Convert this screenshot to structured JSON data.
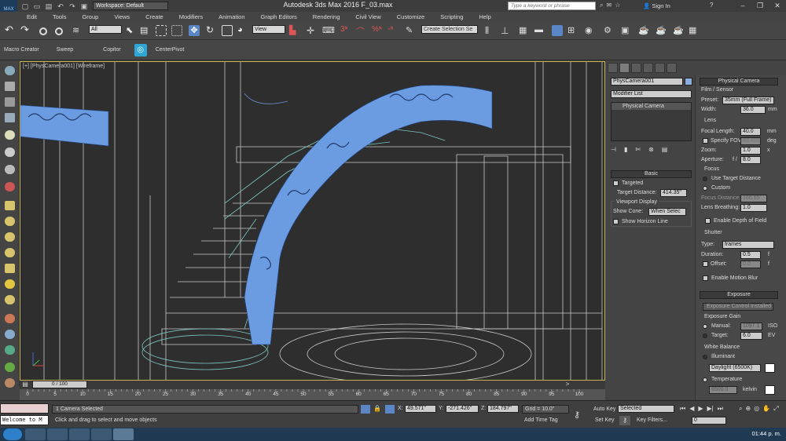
{
  "titlebar": {
    "logo": "MAX",
    "workspace": "Workspace: Default",
    "title": "Autodesk 3ds Max 2016    F_03.max",
    "search_placeholder": "Type a keyword or phrase",
    "sign_in": "Sign In",
    "help": "?"
  },
  "menus": [
    "Edit",
    "Tools",
    "Group",
    "Views",
    "Create",
    "Modifiers",
    "Animation",
    "Graph Editors",
    "Rendering",
    "Civil View",
    "Customize",
    "Scripting",
    "Help"
  ],
  "toolbar": {
    "selection_filter": "All",
    "ref_coord": "View",
    "named_sel": "Create Selection Se"
  },
  "ribbon": {
    "items": [
      "Macro Creator",
      "Sweep",
      "Copitor",
      "CenterPivot"
    ]
  },
  "viewport": {
    "label": "[+] [PhysCamera001] [Wireframe]"
  },
  "command_panel": {
    "object_name": "PhysCamera001",
    "color": "#8aaee0",
    "modifier_list": "Modifier List",
    "stack_item": "Physical Camera",
    "basic": {
      "title": "Basic",
      "targeted": "Targeted",
      "target_distance_label": "Target Distance:",
      "target_distance": "414.35\"",
      "viewport_display": "Viewport Display",
      "show_cone_label": "Show Cone:",
      "show_cone": "When Selec",
      "show_horizon": "Show Horizon Line"
    },
    "physical_camera": {
      "title": "Physical Camera",
      "film_sensor": "Film / Sensor",
      "preset_label": "Preset:",
      "preset": "35mm (Full Frame)",
      "width_label": "Width:",
      "width": "36.0",
      "width_unit": "mm",
      "lens": "Lens",
      "focal_length_label": "Focal Length:",
      "focal_length": "40.0",
      "focal_unit": "mm",
      "specify_fov": "Specify FOV:",
      "fov": "48.455",
      "fov_unit": "deg",
      "zoom_label": "Zoom:",
      "zoom": "1.0",
      "zoom_unit": "x",
      "aperture_label": "Aperture:",
      "aperture_f": "f /",
      "aperture": "8.0",
      "focus": "Focus",
      "use_target": "Use Target Distance",
      "custom": "Custom",
      "focus_distance_label": "Focus Distance:",
      "focus_distance": "166.65'",
      "lens_breathing_label": "Lens Breathing:",
      "lens_breathing": "1.0",
      "enable_dof": "Enable Depth of Field"
    },
    "shutter": {
      "title": "Shutter",
      "type_label": "Type:",
      "type": "frames",
      "duration_label": "Duration:",
      "duration": "0.5",
      "duration_unit": "f",
      "offset_label": "Offset:",
      "offset": "0.0",
      "offset_unit": "f",
      "motion_blur": "Enable Motion Blur"
    },
    "exposure": {
      "title": "Exposure",
      "control_btn": "Exposure Control Installed",
      "exposure_gain": "Exposure Gain",
      "manual_label": "Manual:",
      "manual": "1097.1",
      "manual_unit": "ISO",
      "target_label": "Target:",
      "target": "6.0",
      "target_unit": "EV",
      "white_balance": "White Balance",
      "illuminant": "Illuminant",
      "illuminant_value": "Daylight (6500K)",
      "temperature": "Temperature",
      "temperature_value": "6500.0",
      "temperature_unit": "kelvin"
    }
  },
  "timeline": {
    "slider": "0 / 100",
    "ticks": [
      "0",
      "5",
      "10",
      "15",
      "20",
      "25",
      "30",
      "35",
      "40",
      "45",
      "50",
      "55",
      "60",
      "65",
      "70",
      "75",
      "80",
      "85",
      "90",
      "95",
      "100"
    ]
  },
  "status": {
    "maxscript": "Welcome to M",
    "selected": "1 Camera Selected",
    "prompt": "Click and drag to select and move objects",
    "x_label": "X:",
    "x": "49.571\"",
    "y_label": "Y:",
    "y": "-271.426\"",
    "z_label": "Z:",
    "z": "184.797\"",
    "grid": "Grid = 10.0\"",
    "add_time_tag": "Add Time Tag",
    "auto_key": "Auto Key",
    "set_key": "Set Key",
    "selected_dd": "Selected",
    "key_filters": "Key Filters...",
    "frame": "0"
  },
  "taskbar": {
    "time": "01:44 p. m."
  }
}
